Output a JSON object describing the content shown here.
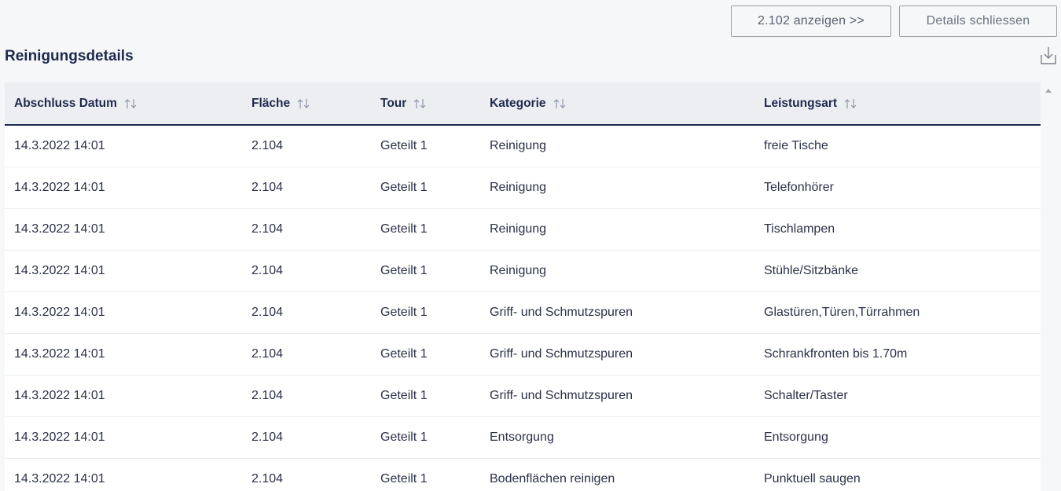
{
  "toolbar": {
    "show_label": "2.102 anzeigen >>",
    "close_label": "Details schliessen"
  },
  "section": {
    "title": "Reinigungsdetails",
    "download_icon": "download-icon"
  },
  "table": {
    "columns": [
      "Abschluss Datum",
      "Fläche",
      "Tour",
      "Kategorie",
      "Leistungsart"
    ],
    "rows": [
      [
        "14.3.2022 14:01",
        "2.104",
        "Geteilt 1",
        "Reinigung",
        "freie Tische"
      ],
      [
        "14.3.2022 14:01",
        "2.104",
        "Geteilt 1",
        "Reinigung",
        "Telefonhörer"
      ],
      [
        "14.3.2022 14:01",
        "2.104",
        "Geteilt 1",
        "Reinigung",
        "Tischlampen"
      ],
      [
        "14.3.2022 14:01",
        "2.104",
        "Geteilt 1",
        "Reinigung",
        "Stühle/Sitzbänke"
      ],
      [
        "14.3.2022 14:01",
        "2.104",
        "Geteilt 1",
        "Griff- und Schmutzspuren",
        "Glastüren,Türen,Türrahmen"
      ],
      [
        "14.3.2022 14:01",
        "2.104",
        "Geteilt 1",
        "Griff- und Schmutzspuren",
        "Schrankfronten bis 1.70m"
      ],
      [
        "14.3.2022 14:01",
        "2.104",
        "Geteilt 1",
        "Griff- und Schmutzspuren",
        "Schalter/Taster"
      ],
      [
        "14.3.2022 14:01",
        "2.104",
        "Geteilt 1",
        "Entsorgung",
        "Entsorgung"
      ],
      [
        "14.3.2022 14:01",
        "2.104",
        "Geteilt 1",
        "Bodenflächen reinigen",
        "Punktuell saugen"
      ]
    ]
  },
  "colors": {
    "accent": "#1d2a4d",
    "sort_icon": "#8f97ad"
  }
}
